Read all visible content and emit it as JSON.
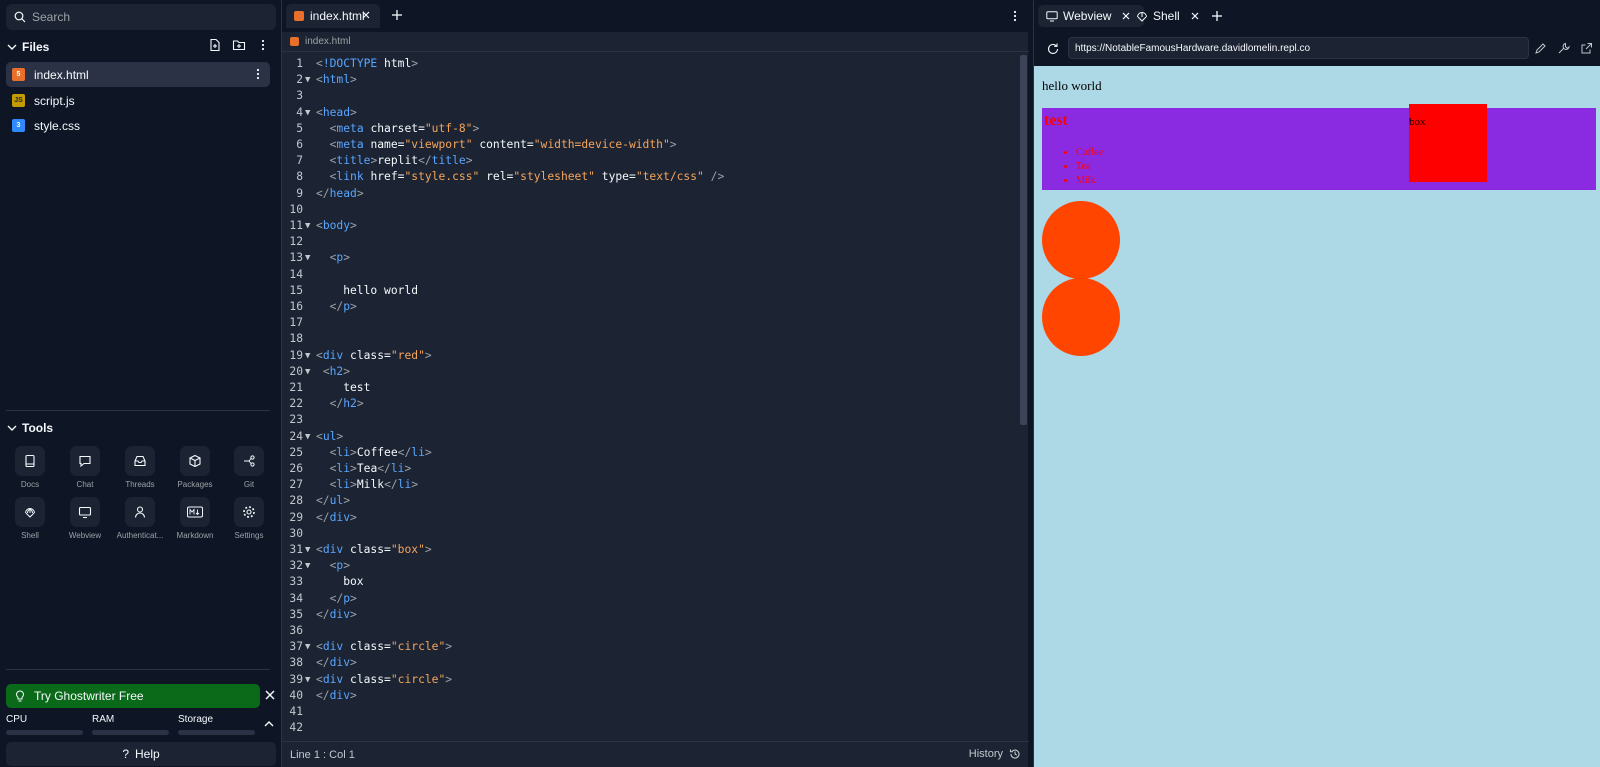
{
  "sidebar": {
    "search_placeholder": "Search",
    "files_title": "Files",
    "files": [
      {
        "name": "index.html",
        "icon": "html5-icon",
        "color": "#e8702a"
      },
      {
        "name": "script.js",
        "icon": "javascript-icon",
        "color": "#c49b00"
      },
      {
        "name": "style.css",
        "icon": "css3-icon",
        "color": "#2f8aff"
      }
    ],
    "tools_title": "Tools",
    "tools": [
      "Docs",
      "Chat",
      "Threads",
      "Packages",
      "Git",
      "Shell",
      "Webview",
      "Authenticat...",
      "Markdown",
      "Settings"
    ],
    "ghostwriter_label": "Try Ghostwriter Free",
    "resources": [
      "CPU",
      "RAM",
      "Storage"
    ],
    "help_label": "Help"
  },
  "editor": {
    "tab_label": "index.html",
    "breadcrumb": "index.html",
    "status_position": "Line 1 : Col 1",
    "history_label": "History",
    "lines": [
      {
        "n": "1",
        "fold": false,
        "html": "<span class='cursor'>|</span><span class='tg'>!DOCTYPE</span> <span class='at'>html</span><span class='tg'>&gt;</span>"
      },
      {
        "n": "2",
        "fold": true
      },
      {
        "n": "3",
        "fold": false
      },
      {
        "n": "4",
        "fold": true
      },
      {
        "n": "5",
        "fold": false
      },
      {
        "n": "6",
        "fold": false
      },
      {
        "n": "7",
        "fold": false
      },
      {
        "n": "8",
        "fold": false
      },
      {
        "n": "9",
        "fold": false
      },
      {
        "n": "10",
        "fold": false
      },
      {
        "n": "11",
        "fold": true
      },
      {
        "n": "12",
        "fold": false
      },
      {
        "n": "13",
        "fold": true
      },
      {
        "n": "14",
        "fold": false
      },
      {
        "n": "15",
        "fold": false
      },
      {
        "n": "16",
        "fold": false
      },
      {
        "n": "17",
        "fold": false
      },
      {
        "n": "18",
        "fold": false
      },
      {
        "n": "19",
        "fold": true
      },
      {
        "n": "20",
        "fold": true
      },
      {
        "n": "21",
        "fold": false
      },
      {
        "n": "22",
        "fold": false
      },
      {
        "n": "23",
        "fold": false
      },
      {
        "n": "24",
        "fold": true
      },
      {
        "n": "25",
        "fold": false
      },
      {
        "n": "26",
        "fold": false
      },
      {
        "n": "27",
        "fold": false
      },
      {
        "n": "28",
        "fold": false
      },
      {
        "n": "29",
        "fold": false
      },
      {
        "n": "30",
        "fold": false
      },
      {
        "n": "31",
        "fold": true
      },
      {
        "n": "32",
        "fold": true
      },
      {
        "n": "33",
        "fold": false
      },
      {
        "n": "34",
        "fold": false
      },
      {
        "n": "35",
        "fold": false
      },
      {
        "n": "36",
        "fold": false
      },
      {
        "n": "37",
        "fold": true
      },
      {
        "n": "38",
        "fold": false
      },
      {
        "n": "39",
        "fold": true
      },
      {
        "n": "40",
        "fold": false
      },
      {
        "n": "41",
        "fold": false
      },
      {
        "n": "42",
        "fold": false
      }
    ],
    "code": [
      [
        [
          "p",
          "<"
        ],
        [
          "t",
          "!DOCTYPE"
        ],
        [
          "x",
          " "
        ],
        [
          "a",
          "html"
        ],
        [
          "p",
          ">"
        ]
      ],
      [
        [
          "p",
          "<"
        ],
        [
          "t",
          "html"
        ],
        [
          "p",
          ">"
        ]
      ],
      [],
      [
        [
          "p",
          "<"
        ],
        [
          "t",
          "head"
        ],
        [
          "p",
          ">"
        ]
      ],
      [
        [
          "x",
          "  "
        ],
        [
          "p",
          "<"
        ],
        [
          "t",
          "meta"
        ],
        [
          "x",
          " "
        ],
        [
          "a",
          "charset"
        ],
        [
          "x",
          "="
        ],
        [
          "s",
          "\"utf-8\""
        ],
        [
          "p",
          ">"
        ]
      ],
      [
        [
          "x",
          "  "
        ],
        [
          "p",
          "<"
        ],
        [
          "t",
          "meta"
        ],
        [
          "x",
          " "
        ],
        [
          "a",
          "name"
        ],
        [
          "x",
          "="
        ],
        [
          "s",
          "\"viewport\""
        ],
        [
          "x",
          " "
        ],
        [
          "a",
          "content"
        ],
        [
          "x",
          "="
        ],
        [
          "s",
          "\"width=device-width\""
        ],
        [
          "p",
          ">"
        ]
      ],
      [
        [
          "x",
          "  "
        ],
        [
          "p",
          "<"
        ],
        [
          "t",
          "title"
        ],
        [
          "p",
          ">"
        ],
        [
          "x",
          "replit"
        ],
        [
          "p",
          "</"
        ],
        [
          "t",
          "title"
        ],
        [
          "p",
          ">"
        ]
      ],
      [
        [
          "x",
          "  "
        ],
        [
          "p",
          "<"
        ],
        [
          "t",
          "link"
        ],
        [
          "x",
          " "
        ],
        [
          "a",
          "href"
        ],
        [
          "x",
          "="
        ],
        [
          "s",
          "\"style.css\""
        ],
        [
          "x",
          " "
        ],
        [
          "a",
          "rel"
        ],
        [
          "x",
          "="
        ],
        [
          "s",
          "\"stylesheet\""
        ],
        [
          "x",
          " "
        ],
        [
          "a",
          "type"
        ],
        [
          "x",
          "="
        ],
        [
          "s",
          "\"text/css\""
        ],
        [
          "x",
          " "
        ],
        [
          "p",
          "/>"
        ]
      ],
      [
        [
          "p",
          "</"
        ],
        [
          "t",
          "head"
        ],
        [
          "p",
          ">"
        ]
      ],
      [],
      [
        [
          "p",
          "<"
        ],
        [
          "t",
          "body"
        ],
        [
          "p",
          ">"
        ]
      ],
      [],
      [
        [
          "x",
          "  "
        ],
        [
          "p",
          "<"
        ],
        [
          "t",
          "p"
        ],
        [
          "p",
          ">"
        ]
      ],
      [],
      [
        [
          "x",
          "    hello world"
        ]
      ],
      [
        [
          "x",
          "  "
        ],
        [
          "p",
          "</"
        ],
        [
          "t",
          "p"
        ],
        [
          "p",
          ">"
        ]
      ],
      [],
      [],
      [
        [
          "p",
          "<"
        ],
        [
          "t",
          "div"
        ],
        [
          "x",
          " "
        ],
        [
          "a",
          "class"
        ],
        [
          "x",
          "="
        ],
        [
          "s",
          "\"red\""
        ],
        [
          "p",
          ">"
        ]
      ],
      [
        [
          "x",
          " "
        ],
        [
          "p",
          "<"
        ],
        [
          "t",
          "h2"
        ],
        [
          "p",
          ">"
        ]
      ],
      [
        [
          "x",
          "    test"
        ]
      ],
      [
        [
          "x",
          "  "
        ],
        [
          "p",
          "</"
        ],
        [
          "t",
          "h2"
        ],
        [
          "p",
          ">"
        ]
      ],
      [],
      [
        [
          "p",
          "<"
        ],
        [
          "t",
          "ul"
        ],
        [
          "p",
          ">"
        ]
      ],
      [
        [
          "x",
          "  "
        ],
        [
          "p",
          "<"
        ],
        [
          "t",
          "li"
        ],
        [
          "p",
          ">"
        ],
        [
          "x",
          "Coffee"
        ],
        [
          "p",
          "</"
        ],
        [
          "t",
          "li"
        ],
        [
          "p",
          ">"
        ]
      ],
      [
        [
          "x",
          "  "
        ],
        [
          "p",
          "<"
        ],
        [
          "t",
          "li"
        ],
        [
          "p",
          ">"
        ],
        [
          "x",
          "Tea"
        ],
        [
          "p",
          "</"
        ],
        [
          "t",
          "li"
        ],
        [
          "p",
          ">"
        ]
      ],
      [
        [
          "x",
          "  "
        ],
        [
          "p",
          "<"
        ],
        [
          "t",
          "li"
        ],
        [
          "p",
          ">"
        ],
        [
          "x",
          "Milk"
        ],
        [
          "p",
          "</"
        ],
        [
          "t",
          "li"
        ],
        [
          "p",
          ">"
        ]
      ],
      [
        [
          "p",
          "</"
        ],
        [
          "t",
          "ul"
        ],
        [
          "p",
          ">"
        ]
      ],
      [
        [
          "p",
          "</"
        ],
        [
          "t",
          "div"
        ],
        [
          "p",
          ">"
        ]
      ],
      [],
      [
        [
          "p",
          "<"
        ],
        [
          "t",
          "div"
        ],
        [
          "x",
          " "
        ],
        [
          "a",
          "class"
        ],
        [
          "x",
          "="
        ],
        [
          "s",
          "\"box\""
        ],
        [
          "p",
          ">"
        ]
      ],
      [
        [
          "x",
          "  "
        ],
        [
          "p",
          "<"
        ],
        [
          "t",
          "p"
        ],
        [
          "p",
          ">"
        ]
      ],
      [
        [
          "x",
          "    box"
        ]
      ],
      [
        [
          "x",
          "  "
        ],
        [
          "p",
          "</"
        ],
        [
          "t",
          "p"
        ],
        [
          "p",
          ">"
        ]
      ],
      [
        [
          "p",
          "</"
        ],
        [
          "t",
          "div"
        ],
        [
          "p",
          ">"
        ]
      ],
      [],
      [
        [
          "p",
          "<"
        ],
        [
          "t",
          "div"
        ],
        [
          "x",
          " "
        ],
        [
          "a",
          "class"
        ],
        [
          "x",
          "="
        ],
        [
          "s",
          "\"circle\""
        ],
        [
          "p",
          ">"
        ]
      ],
      [
        [
          "p",
          "</"
        ],
        [
          "t",
          "div"
        ],
        [
          "p",
          ">"
        ]
      ],
      [
        [
          "p",
          "<"
        ],
        [
          "t",
          "div"
        ],
        [
          "x",
          " "
        ],
        [
          "a",
          "class"
        ],
        [
          "x",
          "="
        ],
        [
          "s",
          "\"circle\""
        ],
        [
          "p",
          ">"
        ]
      ],
      [
        [
          "p",
          "</"
        ],
        [
          "t",
          "div"
        ],
        [
          "p",
          ">"
        ]
      ],
      [],
      []
    ],
    "token_colors": {
      "p": "#9da2a6",
      "t": "#58a6ff",
      "a": "#f5f9fc",
      "s": "#f5a65b",
      "x": "#f5f9fc"
    }
  },
  "webview": {
    "tab_webview": "Webview",
    "tab_shell": "Shell",
    "url": "https://NotableFamousHardware.davidlomelin.repl.co",
    "page": {
      "hello": "hello world",
      "h2": "test",
      "items": [
        "Coffee",
        "Tea",
        "Milk"
      ],
      "box": "box"
    }
  }
}
